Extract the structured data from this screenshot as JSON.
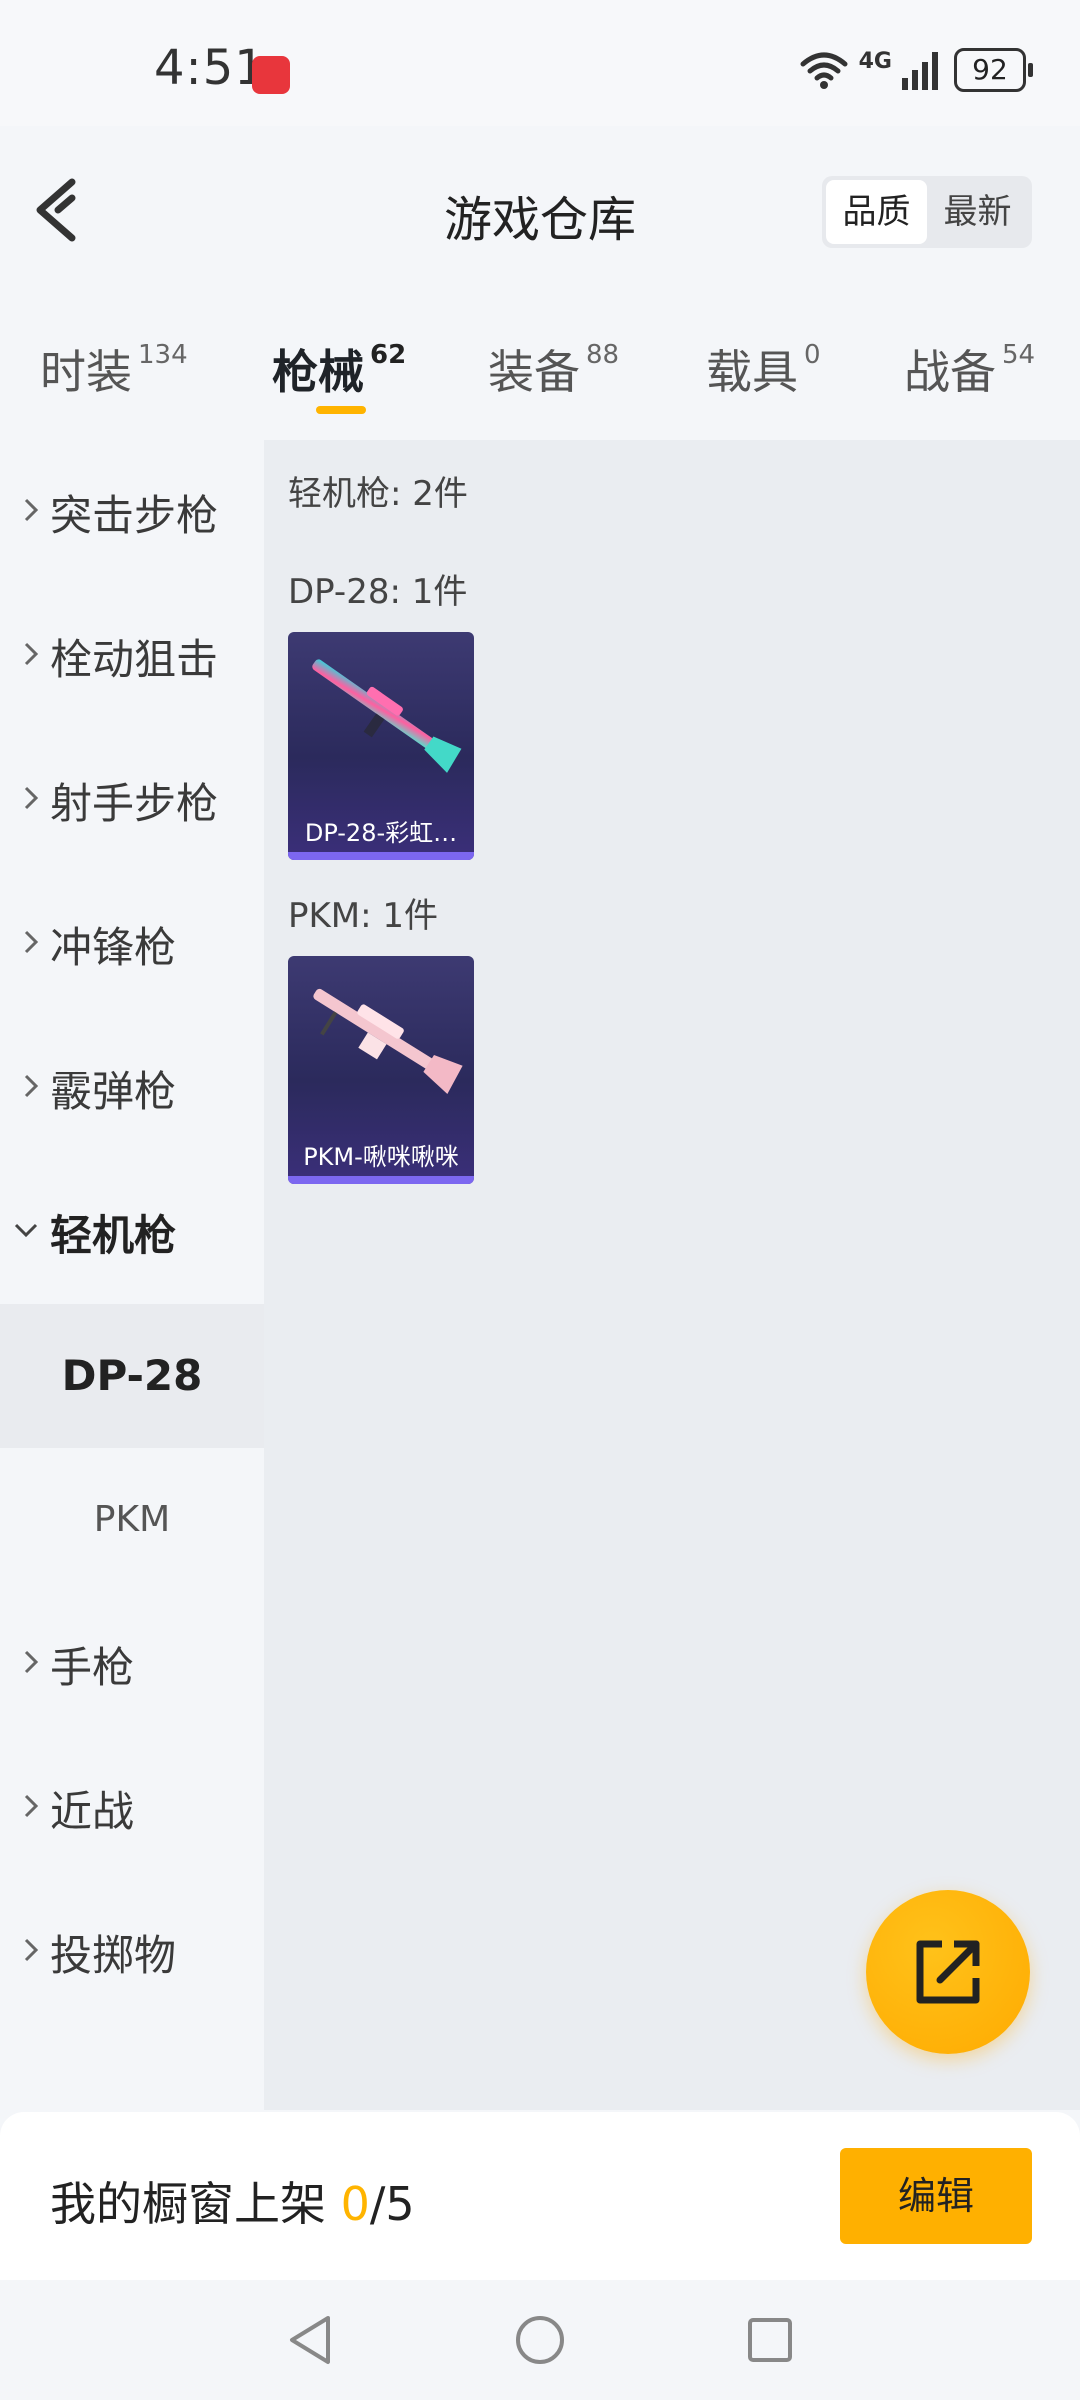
{
  "status": {
    "time": "4:51",
    "network": "4G",
    "battery": "92"
  },
  "header": {
    "title": "游戏仓库",
    "sort": [
      "品质",
      "最新"
    ],
    "sort_active": 0
  },
  "tabs": [
    {
      "label": "时装",
      "count": "134"
    },
    {
      "label": "枪械",
      "count": "62"
    },
    {
      "label": "装备",
      "count": "88"
    },
    {
      "label": "载具",
      "count": "0"
    },
    {
      "label": "战备",
      "count": "54"
    }
  ],
  "active_tab": 1,
  "sidebar": {
    "items": [
      {
        "label": "突击步枪"
      },
      {
        "label": "栓动狙击"
      },
      {
        "label": "射手步枪"
      },
      {
        "label": "冲锋枪"
      },
      {
        "label": "霰弹枪"
      },
      {
        "label": "轻机枪"
      },
      {
        "label": "手枪"
      },
      {
        "label": "近战"
      },
      {
        "label": "投掷物"
      }
    ],
    "sub_items": [
      {
        "label": "DP-28"
      },
      {
        "label": "PKM"
      }
    ]
  },
  "content": {
    "category_title": "轻机枪: 2件",
    "groups": [
      {
        "title": "DP-28: 1件",
        "item_name": "DP-28-彩虹…",
        "icon": "dp28-rainbow-gun-image"
      },
      {
        "title": "PKM: 1件",
        "item_name": "PKM-啾咪啾咪",
        "icon": "pkm-pink-gun-image"
      }
    ]
  },
  "bottom": {
    "label": "我的橱窗上架 ",
    "current": "0",
    "total": "/5",
    "edit": "编辑"
  },
  "colors": {
    "accent": "#ffb400",
    "card_bg": "#2f2d63",
    "card_bar": "#7c67f0"
  }
}
